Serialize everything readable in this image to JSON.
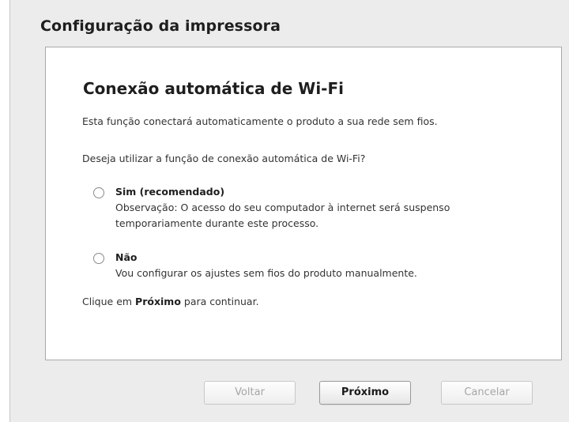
{
  "dialog": {
    "title": "Configuração da impressora"
  },
  "panel": {
    "heading": "Conexão automática de Wi-Fi",
    "intro": "Esta função conectará automaticamente o produto a sua rede sem fios.",
    "question": "Deseja utilizar a função de conexão automática de Wi-Fi?",
    "options": [
      {
        "label": "Sim (recomendado)",
        "description": "Observação: O acesso do seu computador à internet será suspenso temporariamente durante este processo.",
        "selected": false
      },
      {
        "label": "Não",
        "description": "Vou configurar os ajustes sem fios do produto manualmente.",
        "selected": false
      }
    ],
    "continue_prefix": "Clique em ",
    "continue_bold": "Próximo",
    "continue_suffix": " para continuar."
  },
  "buttons": {
    "back": "Voltar",
    "next": "Próximo",
    "cancel": "Cancelar"
  },
  "colors": {
    "window_background": "#ececec",
    "panel_background": "#ffffff",
    "disabled_text": "#a6a6a6"
  }
}
